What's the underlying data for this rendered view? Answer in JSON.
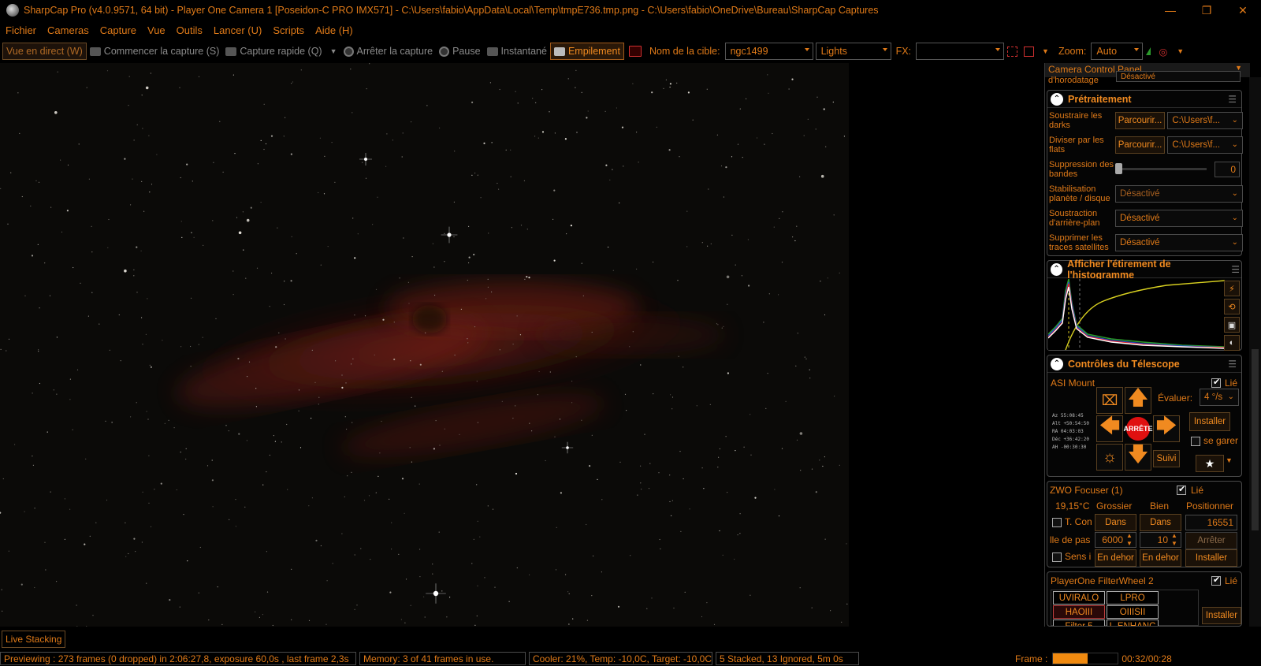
{
  "window": {
    "title": "SharpCap Pro (v4.0.9571, 64 bit) - Player One Camera 1 [Poseidon-C PRO IMX571] - C:\\Users\\fabio\\AppData\\Local\\Temp\\tmpE736.tmp.png - C:\\Users\\fabio\\OneDrive\\Bureau\\SharpCap Captures",
    "minimize": "—",
    "restore": "❐",
    "close": "✕"
  },
  "menu": [
    "Fichier",
    "Cameras",
    "Capture",
    "Vue",
    "Outils",
    "Lancer (U)",
    "Scripts",
    "Aide (H)"
  ],
  "toolbar": {
    "live_view": "Vue en direct (W)",
    "start_capture": "Commencer la capture (S)",
    "quick_capture": "Capture rapide (Q)",
    "stop_capture": "Arrêter la capture",
    "pause": "Pause",
    "snapshot": "Instantané",
    "stacking": "Empilement",
    "target_label": "Nom de la cible:",
    "target_value": "ngc1499",
    "frame_type": "Lights",
    "fx_label": "FX:",
    "fx_value": "",
    "zoom_label": "Zoom:",
    "zoom_value": "Auto"
  },
  "panel": {
    "header": "Camera Control Panel",
    "partial_top": "d'horodatage",
    "partial_top_value": "Désactivé",
    "preprocessing": {
      "title": "Prétraitement",
      "darks_label": "Soustraire les darks",
      "darks_button": "Parcourir...",
      "darks_path": "C:\\Users\\f...",
      "flats_label": "Diviser par les flats",
      "flats_button": "Parcourir...",
      "flats_path": "C:\\Users\\f...",
      "banding_label": "Suppression des bandes",
      "banding_value": "0",
      "stabilization_label": "Stabilisation planète / disque",
      "stabilization_value": "Désactivé",
      "background_label": "Soustraction d'arrière-plan",
      "background_value": "Désactivé",
      "satellite_label": "Supprimer les traces satellites",
      "satellite_value": "Désactivé"
    },
    "histogram": {
      "title": "Afficher l'étirement de l'histogramme"
    },
    "telescope": {
      "title": "Contrôles du Télescope",
      "mount_name": "ASI Mount",
      "linked": "Lié",
      "rate_label": "Évaluer:",
      "rate_value": "4 °/s",
      "stop": "ARRÊTE",
      "install": "Installer",
      "park": "se garer",
      "tracking": "Suivi",
      "coords": [
        "Az  55:08:45",
        "Alt +50:54:50",
        "RA  04:03:03",
        "Déc +36:42:20",
        "AH  -00:30:30"
      ]
    },
    "focuser": {
      "name": "ZWO Focuser (1)",
      "linked": "Lié",
      "temp": "19,15°C",
      "coarse": "Grossier",
      "fine": "Bien",
      "position_label": "Positionner",
      "tcomp": "T. Con",
      "in_coarse": "Dans",
      "in_fine": "Dans",
      "position": "16551",
      "step_label": "lle de pas",
      "step_coarse": "6000",
      "step_fine": "10",
      "stop": "Arrêter",
      "reverse": "Sens i",
      "out_coarse": "En dehor",
      "out_fine": "En dehor",
      "install": "Installer"
    },
    "filterwheel": {
      "name": "PlayerOne FilterWheel 2",
      "linked": "Lié",
      "filters": [
        "UVIRALO",
        "LPRO",
        "HAOIII",
        "OIIISII",
        "Filter 5",
        "L-ENHANC"
      ],
      "install": "Installer"
    }
  },
  "status": {
    "live_stacking_tab": "Live Stacking",
    "preview": "Previewing : 273 frames (0 dropped) in 2:06:27,8, exposure 60,0s , last frame 2,3s",
    "memory": "Memory: 3 of 41 frames in use.",
    "cooler": "Cooler: 21%, Temp: -10,0C, Target: -10,0C",
    "stacked": "5 Stacked, 13 Ignored, 5m 0s",
    "frame_label": "Frame :",
    "frame_progress": 0.53,
    "frame_time": "00:32/00:28"
  },
  "colors": {
    "accent": "#e07a18",
    "nebula": "#7a1a12",
    "stop_red": "#e01010"
  }
}
